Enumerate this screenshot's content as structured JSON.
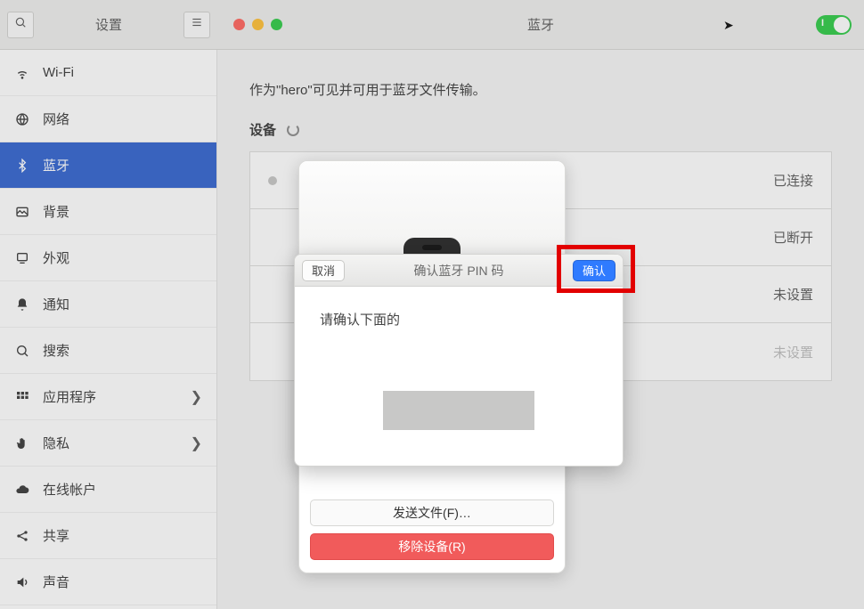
{
  "header": {
    "settings_label": "设置",
    "page_title": "蓝牙"
  },
  "sidebar": {
    "items": [
      {
        "label": "Wi-Fi"
      },
      {
        "label": "网络"
      },
      {
        "label": "蓝牙"
      },
      {
        "label": "背景"
      },
      {
        "label": "外观"
      },
      {
        "label": "通知"
      },
      {
        "label": "搜索"
      },
      {
        "label": "应用程序"
      },
      {
        "label": "隐私"
      },
      {
        "label": "在线帐户"
      },
      {
        "label": "共享"
      },
      {
        "label": "声音"
      }
    ]
  },
  "content": {
    "visibility": "作为\"hero\"可见并可用于蓝牙文件传输。",
    "devices_heading": "设备",
    "device_statuses": [
      "已连接",
      "已断开",
      "未设置",
      "未设置"
    ]
  },
  "popover": {
    "send_file": "发送文件(F)…",
    "remove_device": "移除设备(R)"
  },
  "dialog": {
    "title": "确认蓝牙 PIN 码",
    "cancel": "取消",
    "confirm": "确认",
    "prompt": "请确认下面的"
  }
}
